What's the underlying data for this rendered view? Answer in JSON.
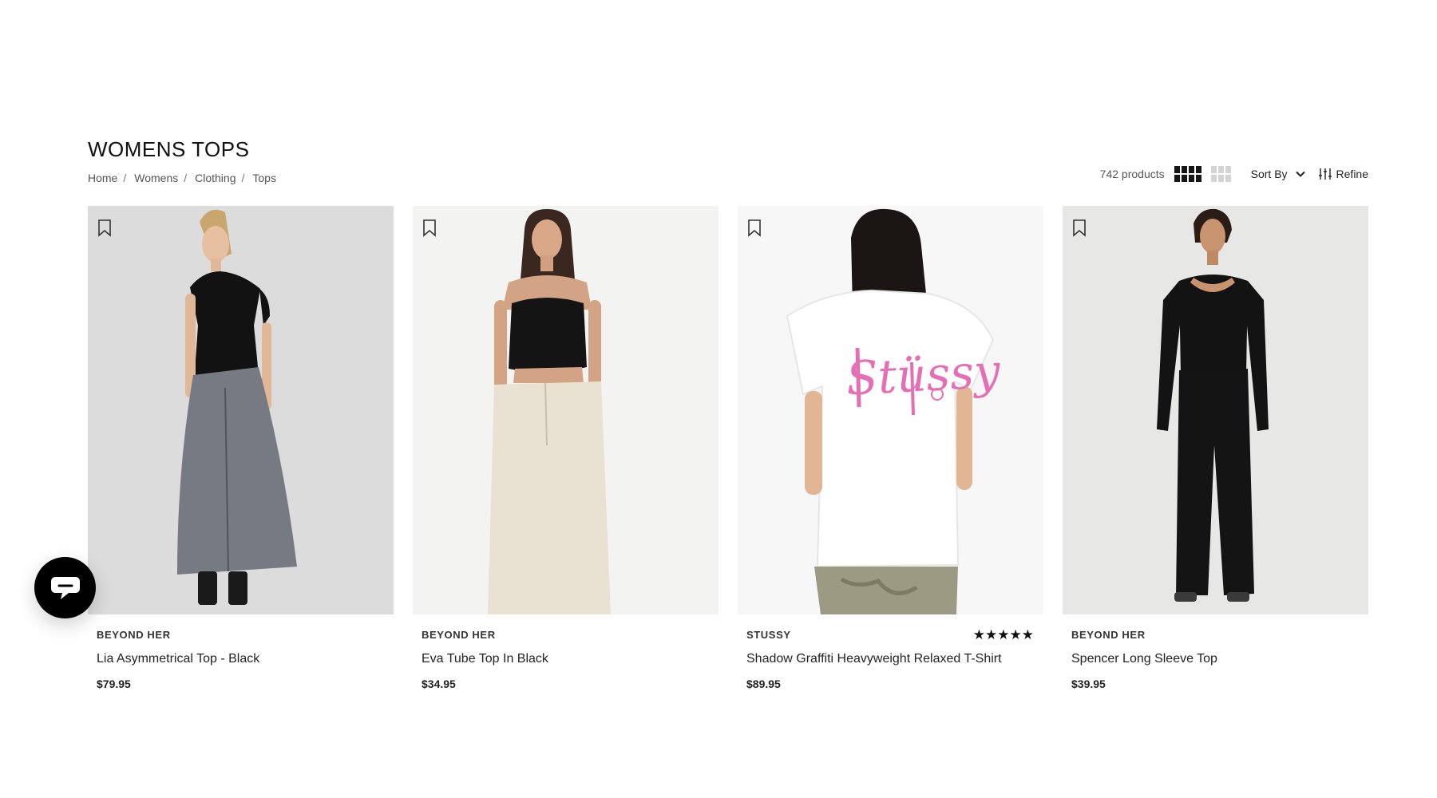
{
  "page": {
    "title": "WOMENS TOPS",
    "breadcrumb": [
      "Home",
      "Womens",
      "Clothing",
      "Tops"
    ]
  },
  "toolbar": {
    "product_count": "742 products",
    "sort_label": "Sort By",
    "refine_label": "Refine",
    "grid_view_active": "4-column"
  },
  "products": [
    {
      "brand": "BEYOND HER",
      "name": "Lia Asymmetrical Top - Black",
      "price": "$79.95",
      "image": "model-black-asymmetric-top-grey-denim-maxi-skirt"
    },
    {
      "brand": "BEYOND HER",
      "name": "Eva Tube Top In Black",
      "price": "$34.95",
      "image": "model-black-corset-tube-top-cream-cargo-pants"
    },
    {
      "brand": "STUSSY",
      "name": "Shadow Graffiti Heavyweight Relaxed T-Shirt",
      "price": "$89.95",
      "rating": 5,
      "rating_glyphs": "★★★★★",
      "image": "model-back-white-tee-pink-graffiti-logo",
      "graphic_text": "Stüssy"
    },
    {
      "brand": "BEYOND HER",
      "name": "Spencer Long Sleeve Top",
      "price": "$39.95",
      "image": "model-black-long-sleeve-top-black-trousers"
    }
  ],
  "icons": {
    "bookmark": "bookmark-icon",
    "sort_chevron": "chevron-down-icon",
    "refine": "sliders-icon",
    "chat": "chat-bubble-icon"
  },
  "colors": {
    "text": "#1a1a1a",
    "muted": "#555555",
    "chat_button": "#000000",
    "graffiti_pink": "#e46fb4"
  }
}
